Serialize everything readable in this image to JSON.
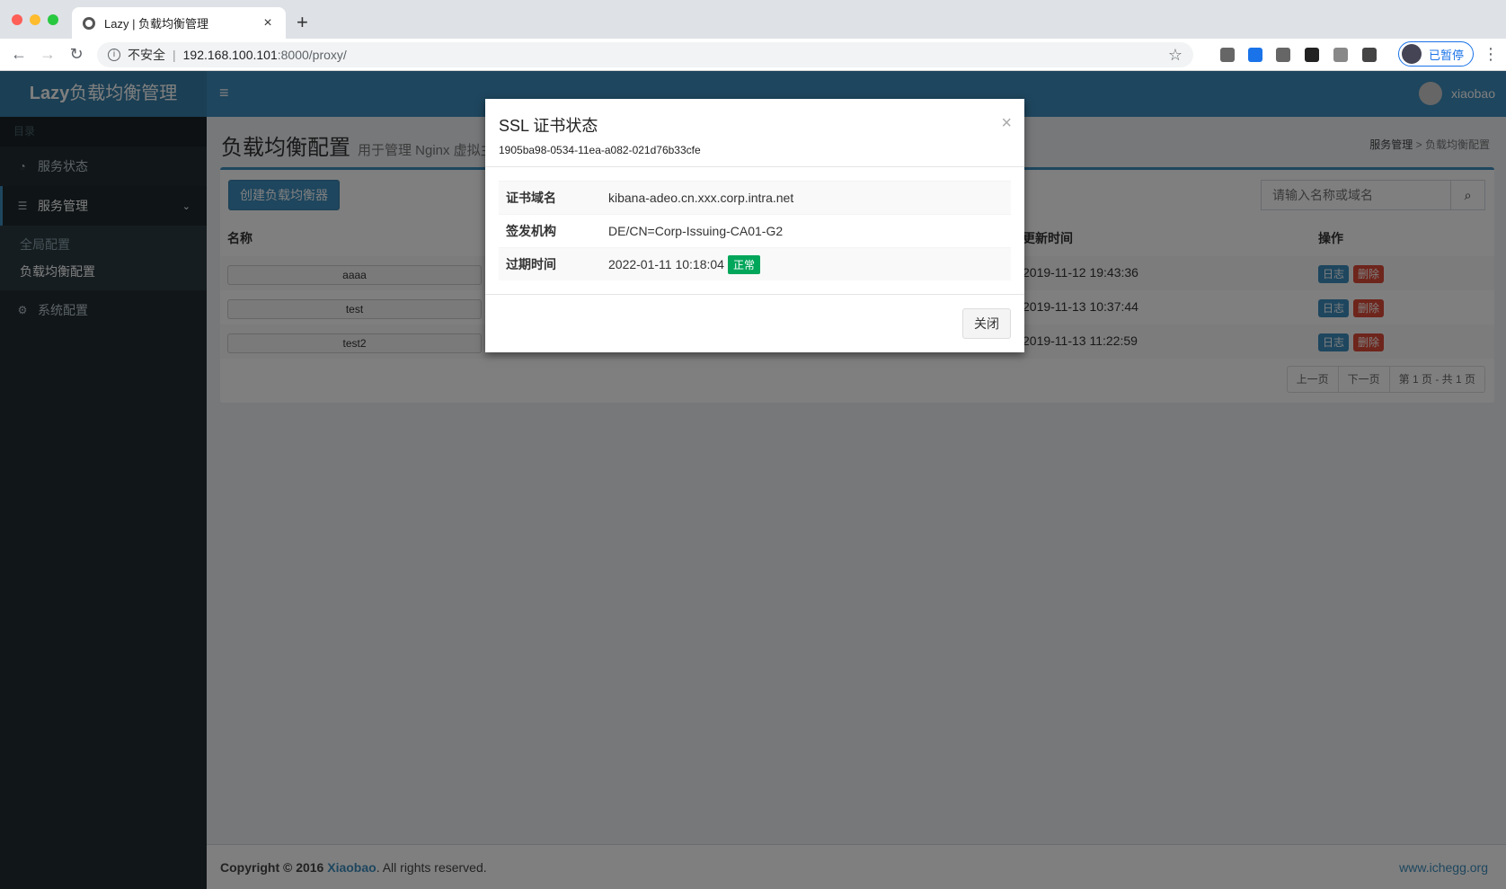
{
  "browser": {
    "tab_title": "Lazy | 负载均衡管理",
    "tab_close": "×",
    "new_tab": "+",
    "insecure_label": "不安全",
    "url_separator": "|",
    "url_host": "192.168.100.101",
    "url_path": ":8000/proxy/",
    "profile_status": "已暂停",
    "traffic_colors": [
      "#fe5f57",
      "#febc2e",
      "#28c840"
    ]
  },
  "header": {
    "logo_bold": "Lazy",
    "logo_rest": "负载均衡管理",
    "menu_icon": "≡",
    "username": "xiaobao"
  },
  "sidebar": {
    "section_label": "目录",
    "items": [
      {
        "label": "服务状态",
        "icon": "dashboard-icon"
      },
      {
        "label": "服务管理",
        "icon": "list-icon"
      },
      {
        "label": "系统配置",
        "icon": "gear-icon"
      }
    ],
    "sub_items": [
      "全局配置",
      "负载均衡配置"
    ]
  },
  "page": {
    "title": "负载均衡配置",
    "subtitle": "用于管理 Nginx 虚拟主机",
    "breadcrumb_1": "服务管理",
    "breadcrumb_sep": ">",
    "breadcrumb_2": "负载均衡配置",
    "create_button": "创建负载均衡器",
    "search_placeholder": "请输入名称或域名"
  },
  "table": {
    "col_name": "名称",
    "col_updated": "更新时间",
    "col_actions": "操作",
    "log_label": "日志",
    "delete_label": "删除",
    "rows": [
      {
        "name": "aaaa",
        "updated": "2019-11-12 19:43:36"
      },
      {
        "name": "test",
        "updated": "2019-11-13 10:37:44"
      },
      {
        "name": "test2",
        "updated": "2019-11-13 11:22:59"
      }
    ],
    "pager_prev": "上一页",
    "pager_next": "下一页",
    "pager_info": "第 1 页 - 共 1 页"
  },
  "footer": {
    "copyright_prefix": "Copyright © 2016",
    "author": "Xiaobao",
    "rights": ". All rights reserved.",
    "site": "www.ichegg.org"
  },
  "modal": {
    "title": "SSL 证书状态",
    "subtitle": "1905ba98-0534-11ea-a082-021d76b33cfe",
    "close_x": "×",
    "rows": [
      {
        "key": "证书域名",
        "value": "kibana-adeo.cn.xxx.corp.intra.net"
      },
      {
        "key": "签发机构",
        "value": "DE/CN=Corp-Issuing-CA01-G2"
      },
      {
        "key": "过期时间",
        "value": "2022-01-11 10:18:04"
      }
    ],
    "status_badge": "正常",
    "close_button": "关闭"
  }
}
